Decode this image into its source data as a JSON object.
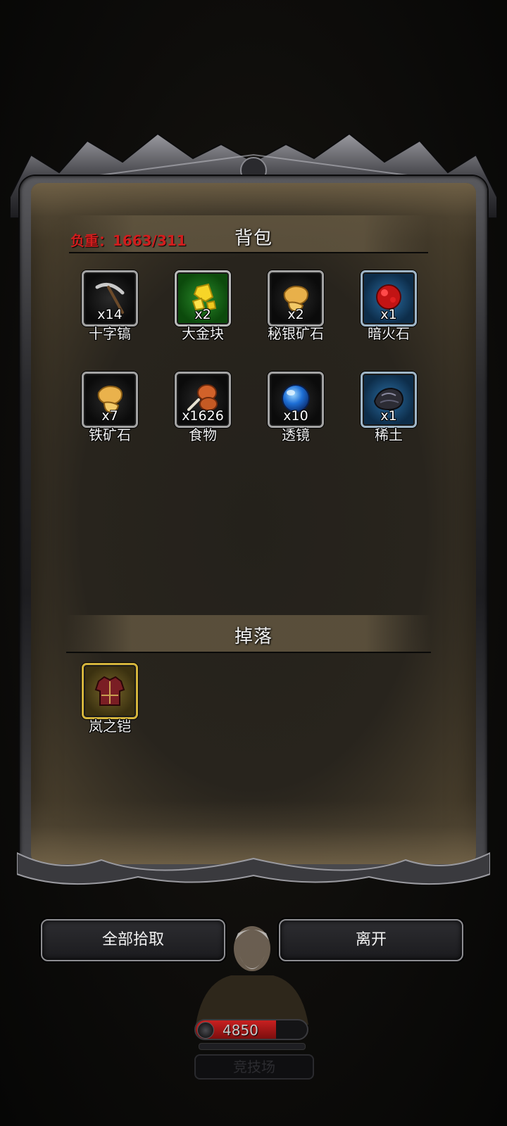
{
  "inventory": {
    "title": "背包",
    "weight_label": "负重：",
    "weight_value": "1663/311",
    "items": [
      {
        "name": "十字镐",
        "count": "x14",
        "icon": "pickaxe-icon",
        "rarity": "grey"
      },
      {
        "name": "大金块",
        "count": "x2",
        "icon": "gold-nugget-icon",
        "rarity": "green"
      },
      {
        "name": "秘银矿石",
        "count": "x2",
        "icon": "mithril-ore-icon",
        "rarity": "grey"
      },
      {
        "name": "暗火石",
        "count": "x1",
        "icon": "dark-fire-stone-icon",
        "rarity": "blue"
      },
      {
        "name": "铁矿石",
        "count": "x7",
        "icon": "iron-ore-icon",
        "rarity": "grey"
      },
      {
        "name": "食物",
        "count": "x1626",
        "icon": "meat-drumstick-icon",
        "rarity": "grey"
      },
      {
        "name": "透镜",
        "count": "x10",
        "icon": "lens-orb-icon",
        "rarity": "grey"
      },
      {
        "name": "稀土",
        "count": "x1",
        "icon": "rare-earth-icon",
        "rarity": "blue"
      }
    ]
  },
  "loot": {
    "title": "掉落",
    "items": [
      {
        "name": "岚之铠",
        "icon": "armor-chestplate-icon",
        "rarity": "gold"
      }
    ]
  },
  "buttons": {
    "pick_all": "全部拾取",
    "leave": "离开"
  },
  "player": {
    "hp": "4850",
    "hp_fraction": 0.72,
    "name_plate": "竞技场"
  },
  "colors": {
    "weight_text": "#d11d1d",
    "rarity_green": "#1d7a1d",
    "rarity_blue": "#1f5a8a",
    "rarity_gold": "#d4b43c",
    "hp_fill": "#c82020"
  }
}
